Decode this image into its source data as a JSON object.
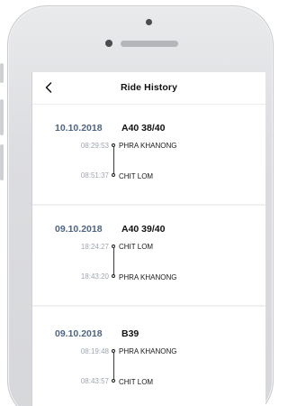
{
  "header": {
    "title": "Ride History",
    "back_icon": "chevron-left-icon"
  },
  "colors": {
    "date": "#4d6583",
    "time": "#9fa6b2",
    "text": "#111111"
  },
  "rides": [
    {
      "date": "10.10.2018",
      "route": "A40 38/40",
      "start_time": "08:29:53",
      "start_stop": "PHRA KHANONG",
      "end_time": "08:51:37",
      "end_stop": "CHIT LOM"
    },
    {
      "date": "09.10.2018",
      "route": "A40 39/40",
      "start_time": "18:24:27",
      "start_stop": "CHIT LOM",
      "end_time": "18:43:20",
      "end_stop": "PHRA KHANONG"
    },
    {
      "date": "09.10.2018",
      "route": "B39",
      "start_time": "08:19:48",
      "start_stop": "PHRA KHANONG",
      "end_time": "08:43:57",
      "end_stop": "CHIT LOM"
    }
  ]
}
